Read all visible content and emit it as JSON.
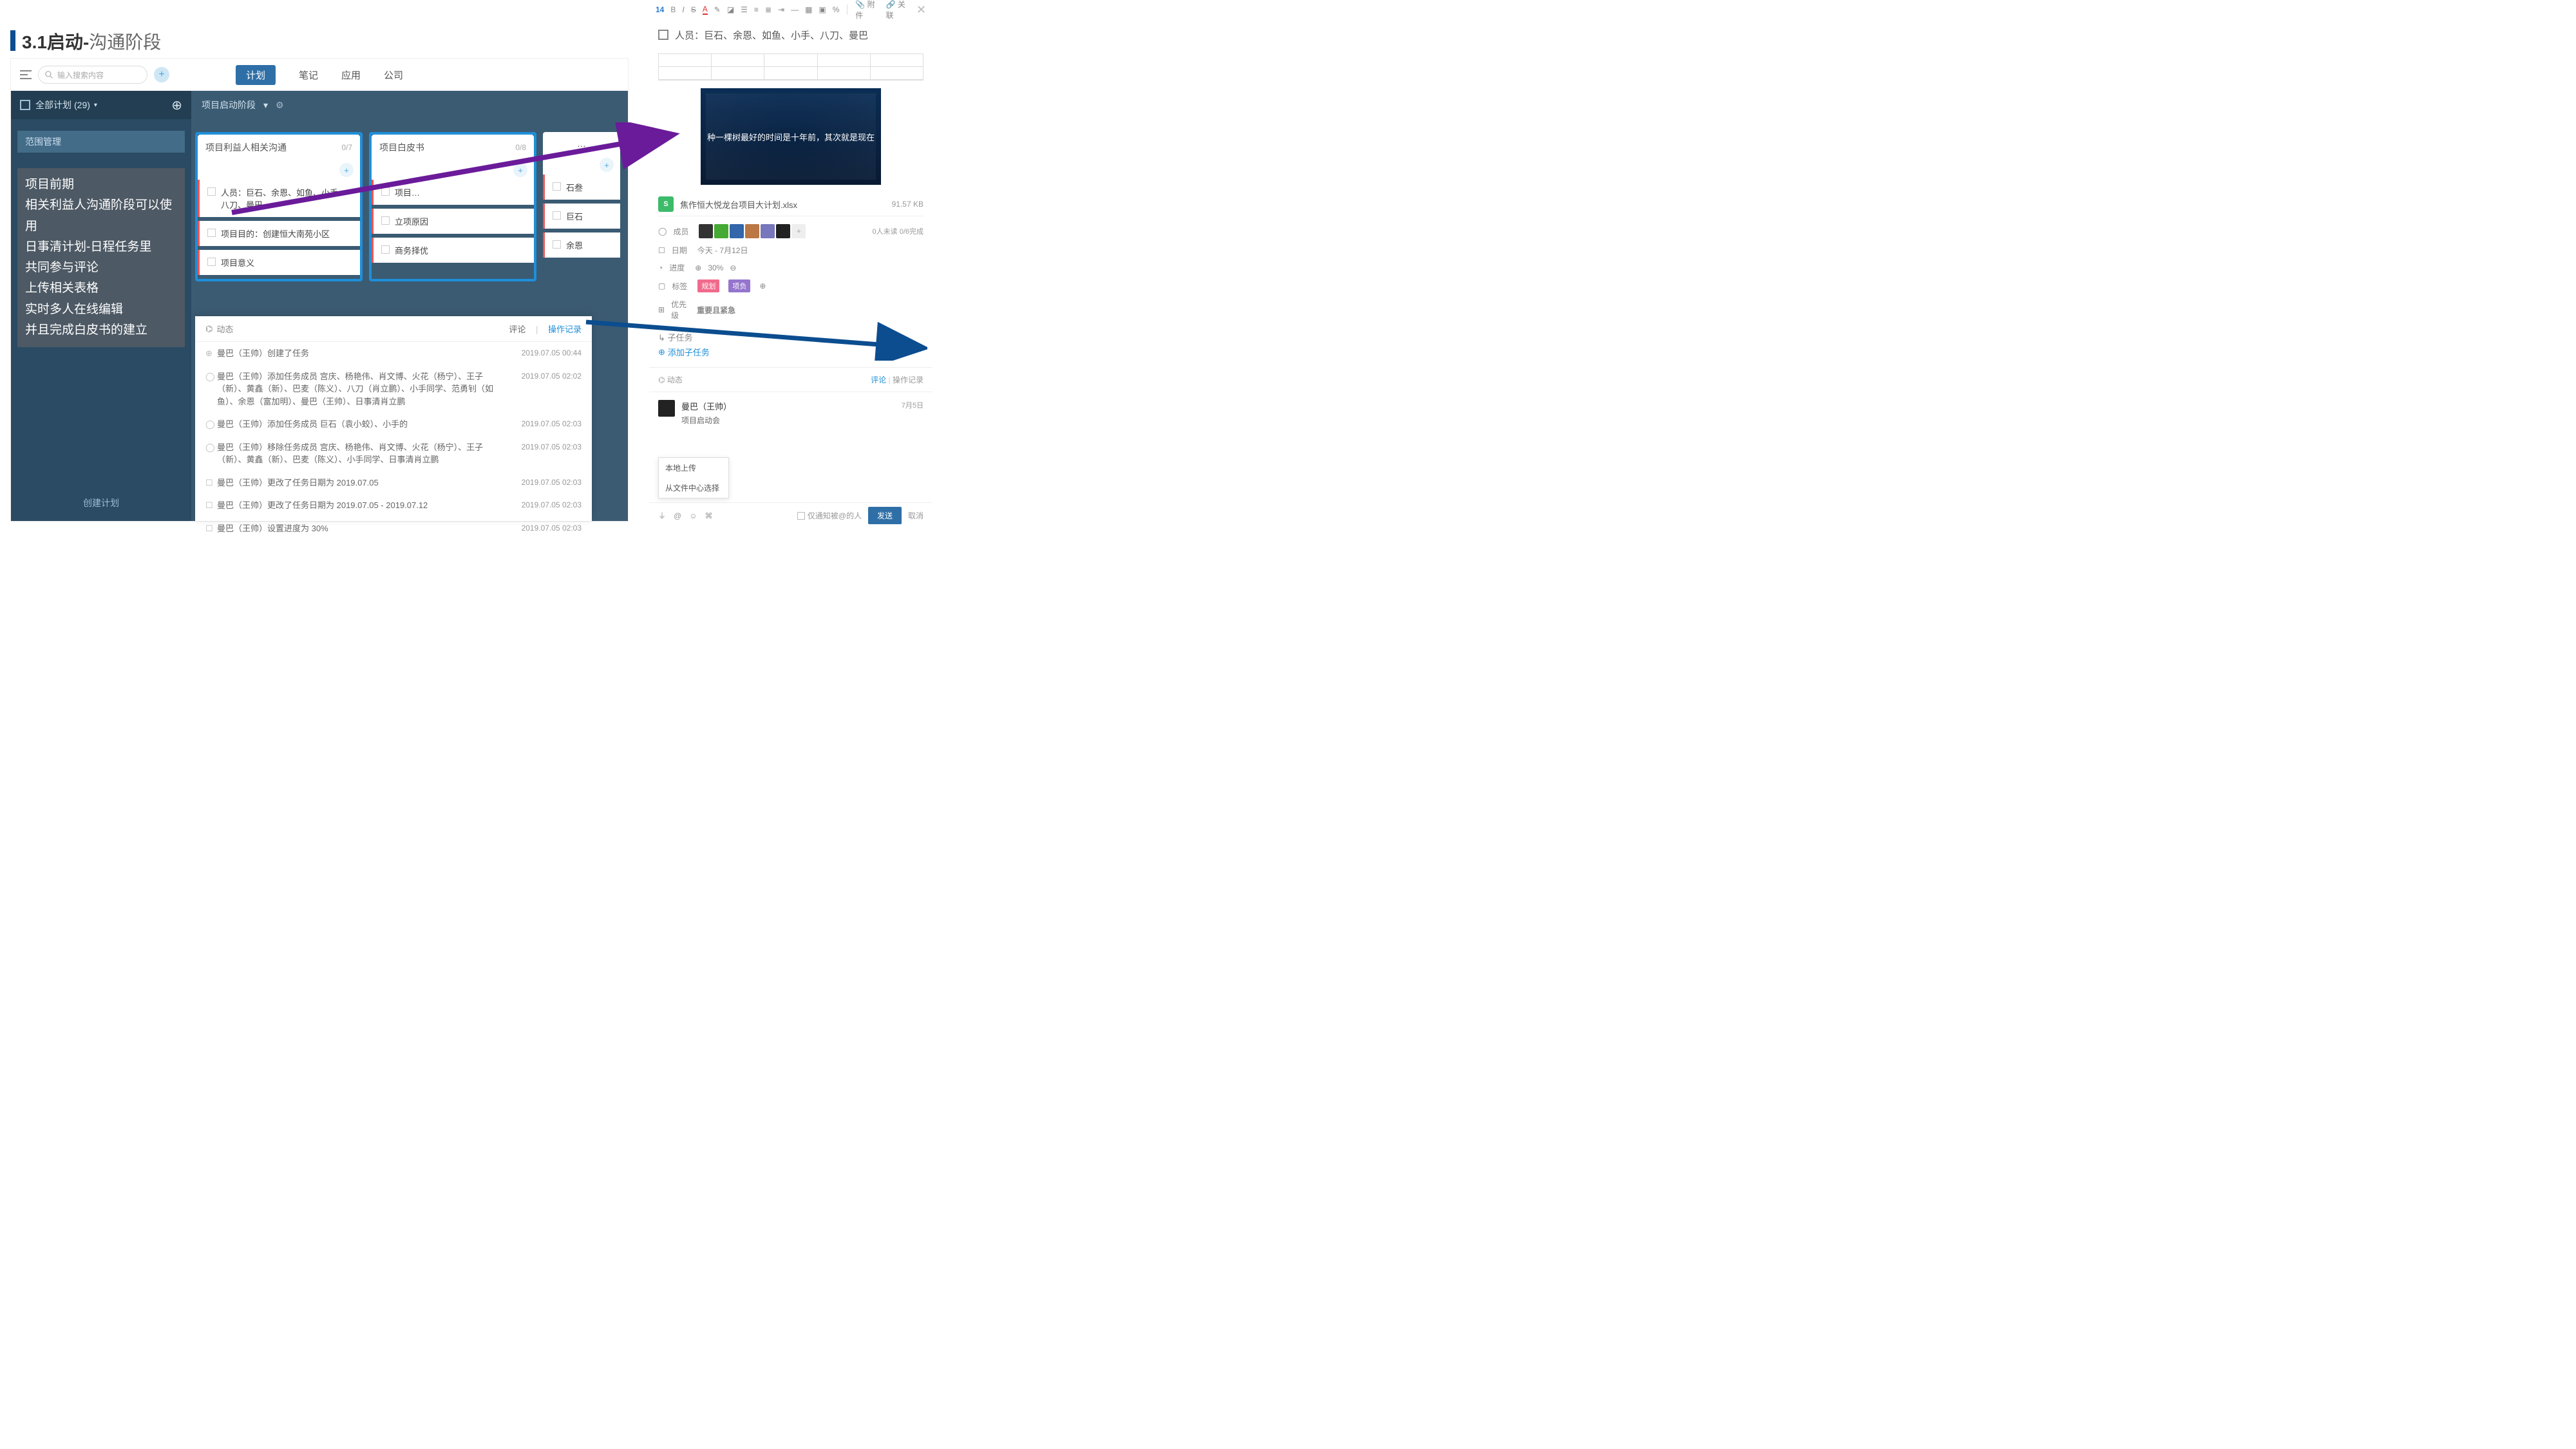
{
  "slide": {
    "num": "3.1",
    "title_bold": "启动-",
    "title_light": "沟通阶段"
  },
  "nav": {
    "items": [
      "计划",
      "笔记",
      "应用",
      "公司"
    ],
    "active": "计划"
  },
  "search": {
    "placeholder": "输入搜索内容"
  },
  "sidebar": {
    "all_plans_label": "全部计划",
    "all_plans_count": "(29)",
    "box_title": "范围管理",
    "footer": "创建计划"
  },
  "annotation_text": "项目前期\n相关利益人沟通阶段可以使用\n日事清计划-日程任务里\n共同参与评论\n上传相关表格\n实时多人在线编辑\n并且完成白皮书的建立",
  "board": {
    "title": "项目启动阶段",
    "columns": [
      {
        "title": "项目利益人相关沟通",
        "count": "0/7",
        "cards": [
          "人员：巨石、余恩、如鱼、小手、八刀、曼巴",
          "项目目的：创建恒大南苑小区",
          "项目意义"
        ]
      },
      {
        "title": "项目白皮书",
        "count": "0/8",
        "cards": [
          "项目…",
          "立项原因",
          "商务择优"
        ]
      },
      {
        "title": "…",
        "count": "",
        "cards": [
          "石叁",
          "巨石",
          "余恩"
        ]
      }
    ]
  },
  "activity": {
    "head_left": "动态",
    "tab_comment": "评论",
    "tab_log": "操作记录",
    "logs": [
      {
        "icon": "⊕",
        "text": "曼巴（王帅）创建了任务",
        "ts": "2019.07.05 00:44"
      },
      {
        "icon": "◯",
        "text": "曼巴（王帅）添加任务成员 宫庆、杨艳伟、肖文博、火花（杨宁）、王子（新）、黄鑫（新）、巴麦（陈义）、八刀（肖立鹏）、小手同学、范勇钊（如鱼）、余恩（富加明）、曼巴（王帅）、日事清肖立鹏",
        "ts": "2019.07.05 02:02"
      },
      {
        "icon": "◯",
        "text": "曼巴（王帅）添加任务成员 巨石（袁小蛟）、小手的",
        "ts": "2019.07.05 02:03"
      },
      {
        "icon": "◯",
        "text": "曼巴（王帅）移除任务成员 宫庆、杨艳伟、肖文博、火花（杨宁）、王子（新）、黄鑫（新）、巴麦（陈义）、小手同学、日事清肖立鹏",
        "ts": "2019.07.05 02:03"
      },
      {
        "icon": "☐",
        "text": "曼巴（王帅）更改了任务日期为 2019.07.05",
        "ts": "2019.07.05 02:03"
      },
      {
        "icon": "☐",
        "text": "曼巴（王帅）更改了任务日期为 2019.07.05 - 2019.07.12",
        "ts": "2019.07.05 02:03"
      },
      {
        "icon": "☐",
        "text": "曼巴（王帅）设置进度为 30%",
        "ts": "2019.07.05 02:03"
      }
    ]
  },
  "detail": {
    "toolbar": {
      "fontsize": "14",
      "attach": "附件",
      "relate": "关联"
    },
    "title": "人员：巨石、余恩、如鱼、小手、八刀、曼巴",
    "poster_text": "种一棵树最好的时间是十年前，其次就是现在",
    "file": {
      "name": "焦作恒大悦龙台项目大计划.xlsx",
      "size": "91.57 KB"
    },
    "members_label": "成员",
    "readers": "0人未读 0/6完成",
    "date_label": "日期",
    "date_value": "今天 - 7月12日",
    "progress_label": "进度",
    "progress_value": "30%",
    "tags_label": "标签",
    "tag1": "规划",
    "tag2": "项负",
    "priority_label": "优先级",
    "priority_value": "重要且紧急",
    "subtask_label": "子任务",
    "subtask_add": "添加子任务",
    "act_left": "动态",
    "act_comment": "评论",
    "act_log": "操作记录",
    "comment": {
      "name": "曼巴（王帅）",
      "date": "7月5日",
      "body": "项目启动会"
    },
    "upload": {
      "local": "本地上传",
      "center": "从文件中心选择"
    },
    "compose": {
      "notify": "仅通知被@的人",
      "send": "发送",
      "cancel": "取消"
    }
  }
}
